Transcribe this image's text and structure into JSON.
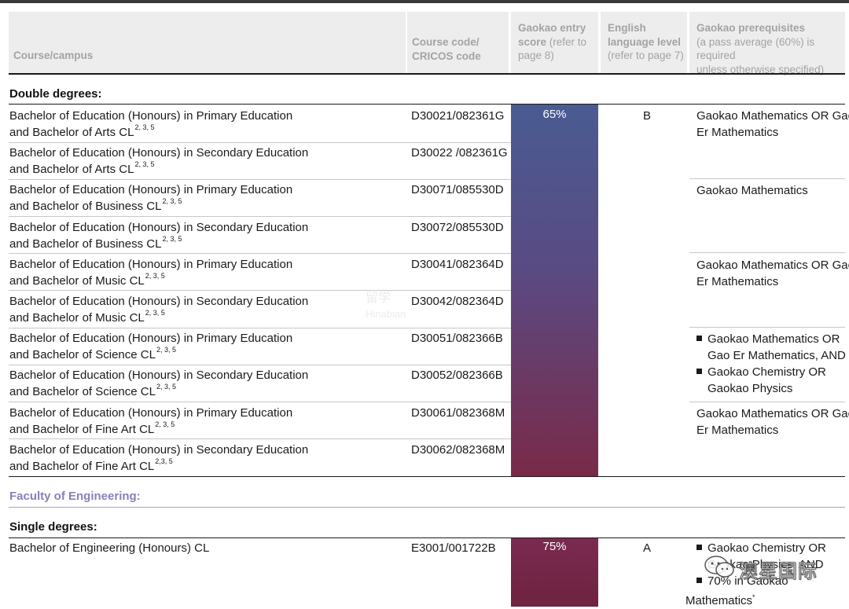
{
  "header": {
    "course": "Course/campus",
    "code_line1": "Course code/",
    "code_line2": "CRICOS code",
    "score_bold": "Gaokao entry",
    "score_bold2": "score",
    "score_light": " (refer to",
    "score_light2": "page 8)",
    "english_bold1": "English",
    "english_bold2": "language level",
    "english_light": "(refer to page 7)",
    "prereq_bold": "Gaokao prerequisites",
    "prereq_light1": "(a pass average (60%) is required",
    "prereq_light2": "unless otherwise specified)"
  },
  "sections": {
    "double": "Double degrees:",
    "faculty": "Faculty of Engineering:",
    "single": "Single degrees:"
  },
  "double_rows": [
    {
      "l1": "Bachelor of Education (Honours) in Primary Education",
      "l2": "and Bachelor of Arts  CL",
      "sup": "2, 3, 5",
      "code": "D30021/082361G"
    },
    {
      "l1": "Bachelor of Education (Honours) in Secondary Education",
      "l2": "and Bachelor of Arts  CL",
      "sup": "2, 3, 5",
      "code": "D30022 /082361G"
    },
    {
      "l1": "Bachelor of Education (Honours) in Primary Education",
      "l2": "and Bachelor of Business  CL",
      "sup": "2, 3, 5",
      "code": "D30071/085530D"
    },
    {
      "l1": "Bachelor of Education (Honours) in Secondary Education",
      "l2": "and Bachelor of Business  CL",
      "sup": "2, 3, 5",
      "code": "D30072/085530D"
    },
    {
      "l1": "Bachelor of Education (Honours) in Primary Education",
      "l2": "and Bachelor of Music  CL",
      "sup": "2, 3, 5",
      "code": "D30041/082364D"
    },
    {
      "l1": "Bachelor of Education (Honours) in Secondary Education",
      "l2": "and Bachelor of Music  CL",
      "sup": "2, 3, 5",
      "code": "D30042/082364D"
    },
    {
      "l1": "Bachelor of Education (Honours) in Primary Education",
      "l2": "and Bachelor of Science  CL",
      "sup": "2, 3, 5",
      "code": "D30051/082366B"
    },
    {
      "l1": "Bachelor of Education (Honours) in Secondary Education",
      "l2": "and Bachelor of Science  CL",
      "sup": "2, 3, 5",
      "code": "D30052/082366B"
    },
    {
      "l1": "Bachelor of Education (Honours) in Primary Education",
      "l2": "and Bachelor of Fine Art  CL",
      "sup": "2, 3, 5",
      "code": "D30061/082368M"
    },
    {
      "l1": "Bachelor of Education (Honours) in Secondary Education",
      "l2": "and Bachelor of Fine Art  CL",
      "sup": "2,3, 5",
      "code": "D30062/082368M"
    }
  ],
  "double_score": "65%",
  "double_english": "B",
  "prereqs": {
    "p1_l1": "Gaokao Mathematics OR Gao",
    "p1_l2": "Er Mathematics",
    "p2": "Gaokao Mathematics",
    "p3_l1": "Gaokao Mathematics OR Gao",
    "p3_l2": "Er Mathematics",
    "p4_b1_l1": "Gaokao Mathematics OR",
    "p4_b1_l2": "Gao Er Mathematics, AND",
    "p4_b2_l1": "Gaokao Chemistry OR",
    "p4_b2_l2": "Gaokao Physics",
    "p5_l1": "Gaokao Mathematics OR Gao",
    "p5_l2": "Er Mathematics"
  },
  "single_row": {
    "course": "Bachelor of Engineering (Honours)  CL",
    "code": "E3001/001722B",
    "score": "75%",
    "english": "A",
    "b1": "Gaokao Chemistry OR",
    "b1_l2": "Gaokao Physics, AND",
    "b2": "70% in Gaokao",
    "b2_l2": "Mathematics",
    "b2_sup": "*"
  },
  "watermark": {
    "text": "澳星国际",
    "faint1": "留学",
    "faint2": "Hinabian"
  },
  "colors": {
    "score_top": "#4a5b92",
    "score_bottom": "#7a2a48"
  }
}
